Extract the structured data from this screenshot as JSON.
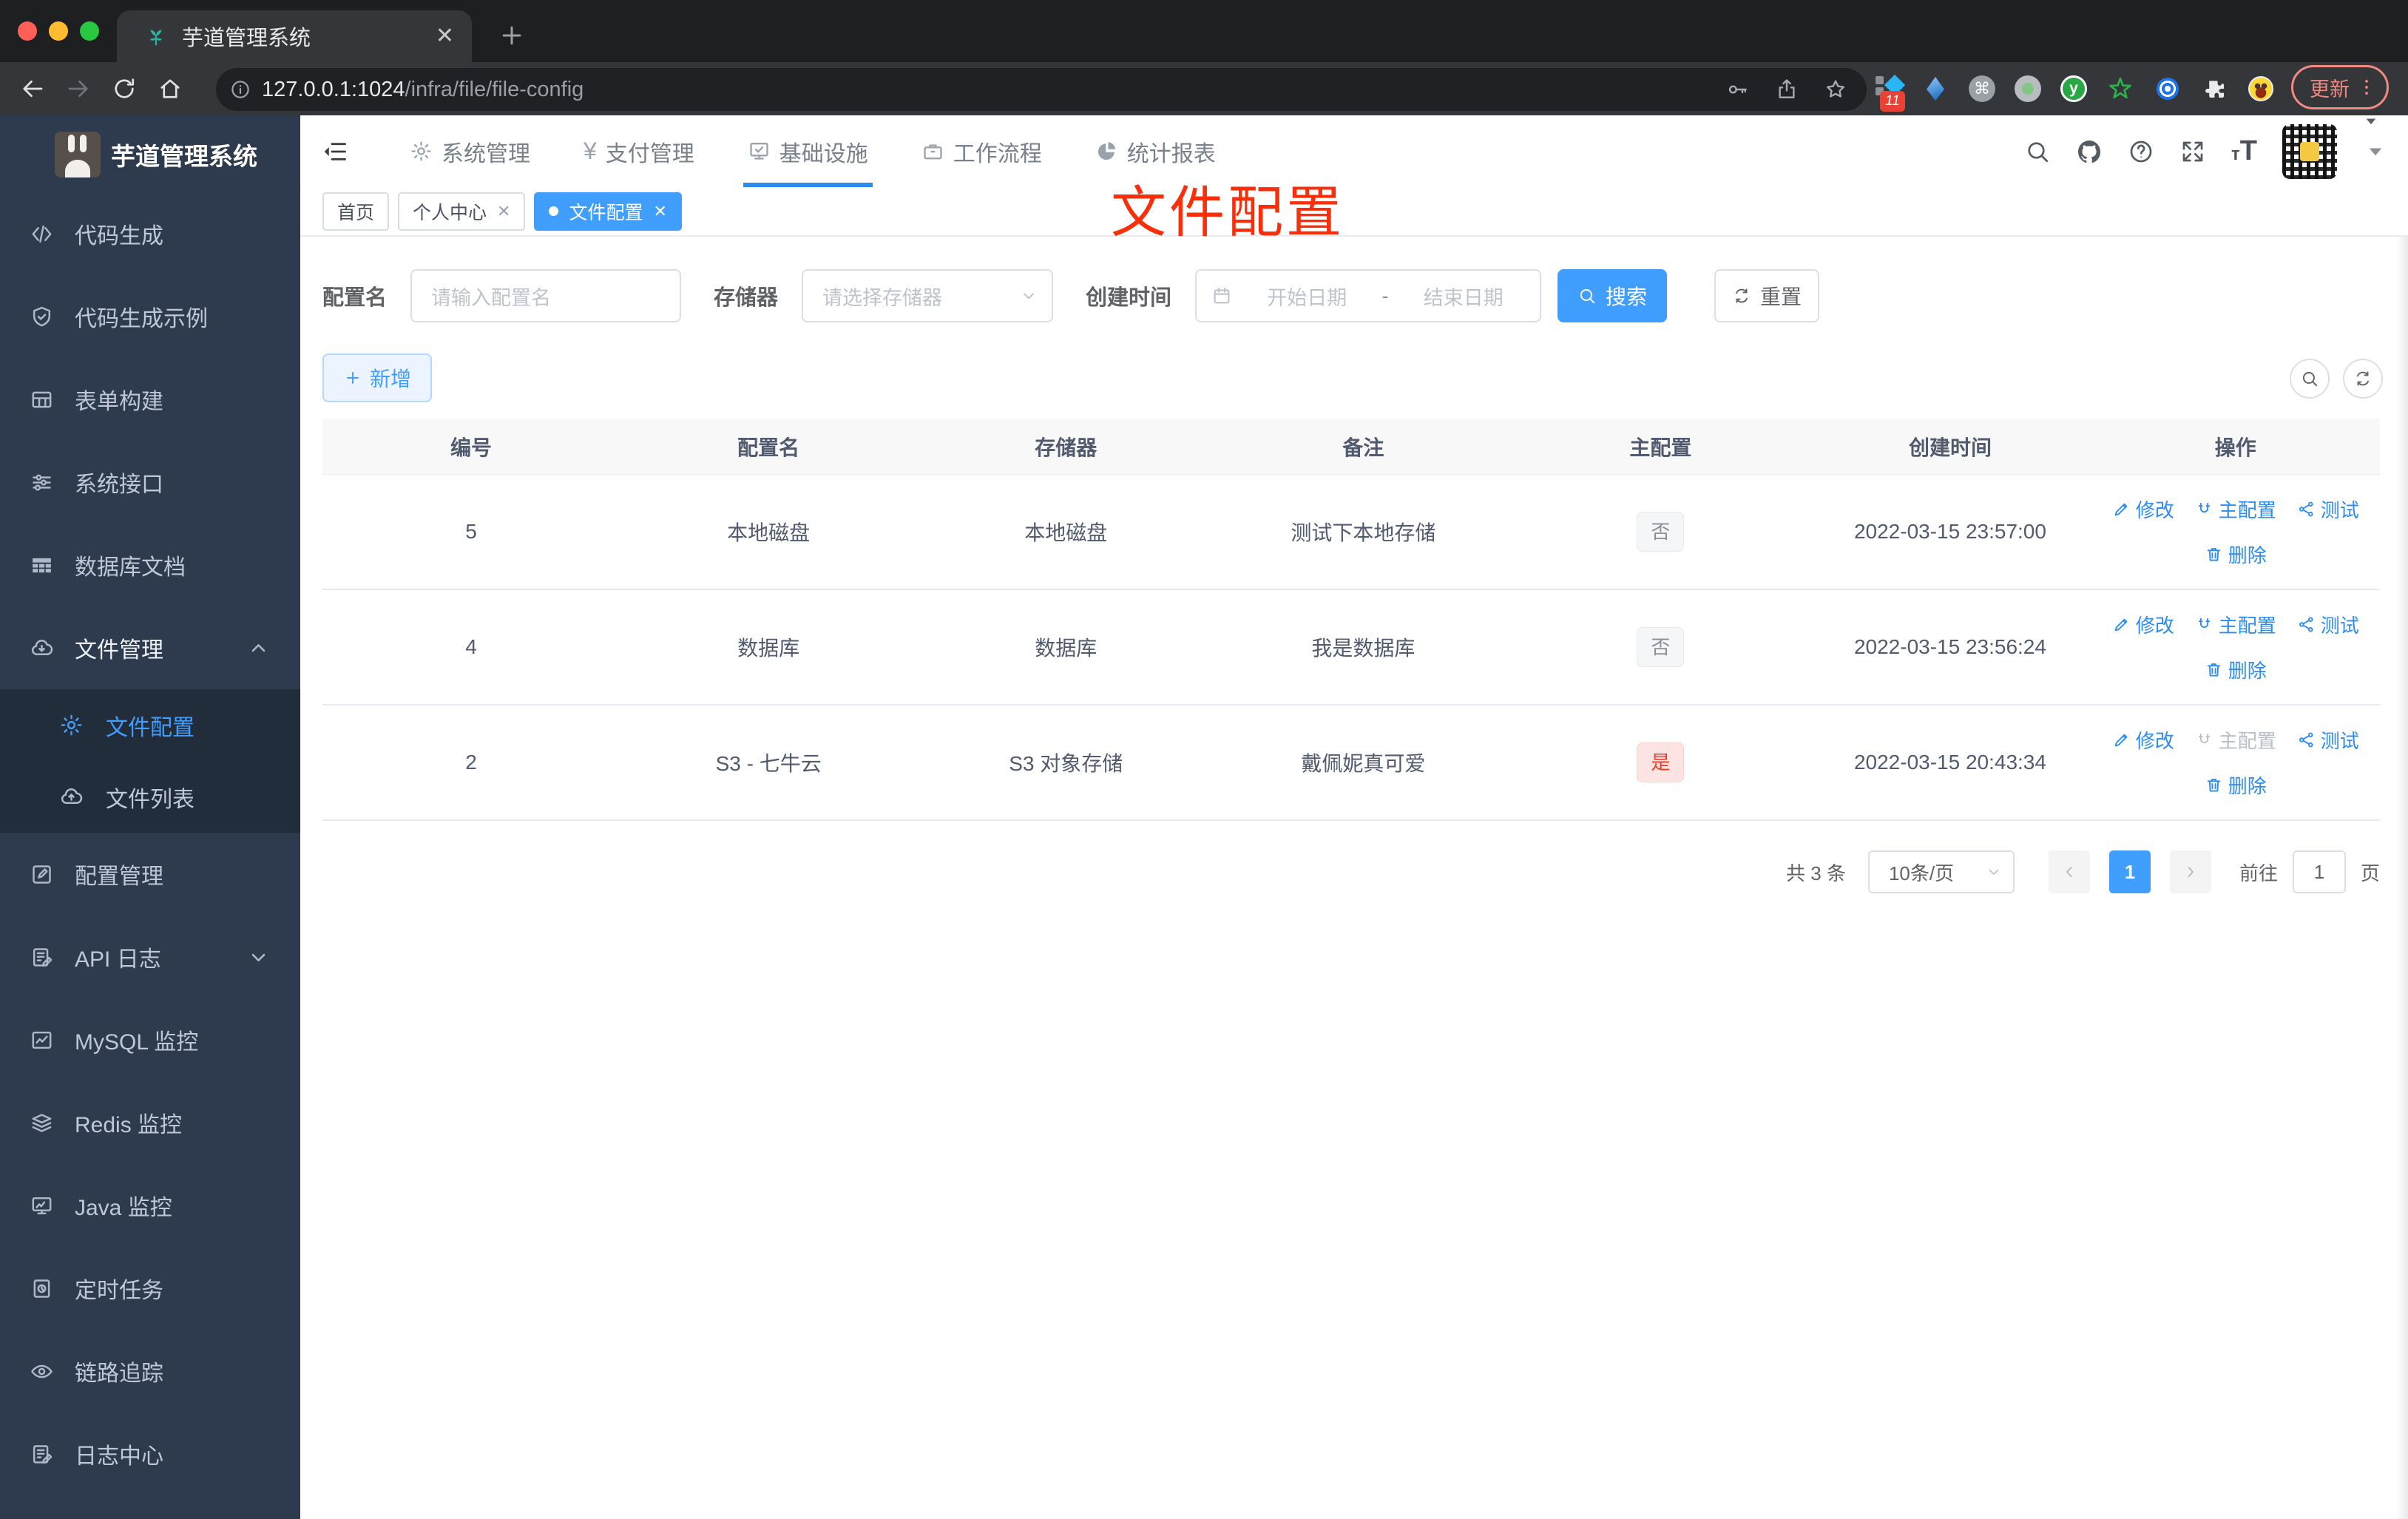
{
  "browser": {
    "tab_title": "芋道管理系统",
    "url_host": "127.0.0.1:1024",
    "url_path": "/infra/file/file-config",
    "update_label": "更新",
    "extensions_badge": "11"
  },
  "sidebar": {
    "title": "芋道管理系统",
    "items": [
      {
        "label": "代码生成",
        "icon": "code"
      },
      {
        "label": "代码生成示例",
        "icon": "shield-check"
      },
      {
        "label": "表单构建",
        "icon": "form-grid"
      },
      {
        "label": "系统接口",
        "icon": "sliders"
      },
      {
        "label": "数据库文档",
        "icon": "table-filled"
      },
      {
        "label": "文件管理",
        "icon": "cloud-down",
        "chevron": "up",
        "parent": true,
        "children": [
          {
            "label": "文件配置",
            "icon": "gear",
            "active": true
          },
          {
            "label": "文件列表",
            "icon": "cloud-up"
          }
        ]
      },
      {
        "label": "配置管理",
        "icon": "edit-square"
      },
      {
        "label": "API 日志",
        "icon": "doc-edit",
        "chevron": "down"
      },
      {
        "label": "MySQL 监控",
        "icon": "chart-box"
      },
      {
        "label": "Redis 监控",
        "icon": "layers"
      },
      {
        "label": "Java 监控",
        "icon": "monitor"
      },
      {
        "label": "定时任务",
        "icon": "clock-doc"
      },
      {
        "label": "链路追踪",
        "icon": "eye"
      },
      {
        "label": "日志中心",
        "icon": "doc-edit"
      }
    ]
  },
  "header": {
    "nav": [
      {
        "label": "系统管理",
        "icon": "gear"
      },
      {
        "label": "支付管理",
        "icon": "yen"
      },
      {
        "label": "基础设施",
        "icon": "monitor-check",
        "active": true
      },
      {
        "label": "工作流程",
        "icon": "briefcase"
      },
      {
        "label": "统计报表",
        "icon": "pie"
      }
    ]
  },
  "tabs": [
    {
      "label": "首页"
    },
    {
      "label": "个人中心",
      "closable": true
    },
    {
      "label": "文件配置",
      "closable": true,
      "active": true
    }
  ],
  "annotation": {
    "text": "文件配置",
    "color": "#fa2f0a"
  },
  "filters": {
    "name_label": "配置名",
    "name_placeholder": "请输入配置名",
    "storage_label": "存储器",
    "storage_placeholder": "请选择存储器",
    "time_label": "创建时间",
    "start_placeholder": "开始日期",
    "range_separator": "-",
    "end_placeholder": "结束日期",
    "search_label": "搜索",
    "reset_label": "重置",
    "add_label": "新增"
  },
  "table": {
    "headers": [
      "编号",
      "配置名",
      "存储器",
      "备注",
      "主配置",
      "创建时间",
      "操作"
    ],
    "rows": [
      {
        "id": "5",
        "name": "本地磁盘",
        "storage": "本地磁盘",
        "remark": "测试下本地存储",
        "master": {
          "text": "否",
          "danger": false
        },
        "created": "2022-03-15 23:57:00",
        "master_action_disabled": false
      },
      {
        "id": "4",
        "name": "数据库",
        "storage": "数据库",
        "remark": "我是数据库",
        "master": {
          "text": "否",
          "danger": false
        },
        "created": "2022-03-15 23:56:24",
        "master_action_disabled": false
      },
      {
        "id": "2",
        "name": "S3 - 七牛云",
        "storage": "S3 对象存储",
        "remark": "戴佩妮真可爱",
        "master": {
          "text": "是",
          "danger": true
        },
        "created": "2022-03-15 20:43:34",
        "master_action_disabled": true
      }
    ],
    "actions": {
      "edit": "修改",
      "master": "主配置",
      "test": "测试",
      "delete": "删除"
    }
  },
  "pagination": {
    "total": "共 3 条",
    "page_size": "10条/页",
    "current_page": "1",
    "goto_label": "前往",
    "goto_value": "1",
    "goto_suffix": "页"
  },
  "colors": {
    "accent": "#409eff",
    "link": "#2d8cf0",
    "annotation_red": "#fa2f0a",
    "sidebar_bg": "#2e3b4e",
    "submenu_bg": "#222d3b",
    "tag_danger_text": "#ef3b24"
  }
}
